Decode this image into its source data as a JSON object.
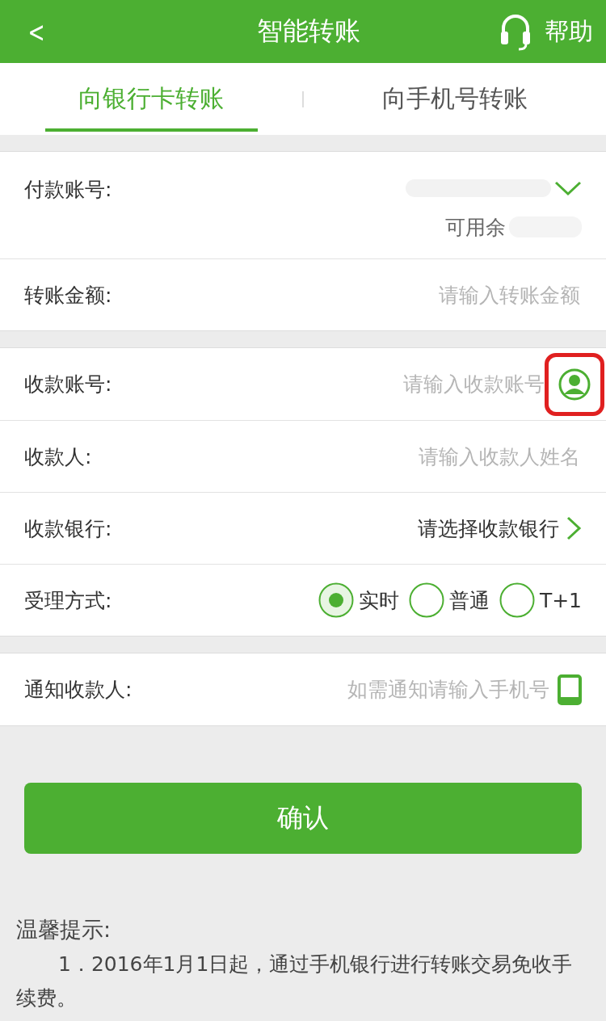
{
  "header": {
    "back": "<",
    "title": "智能转账",
    "help": "帮助"
  },
  "tabs": [
    {
      "label": "向银行卡转账",
      "selected": true
    },
    {
      "label": "向手机号转账",
      "selected": false
    }
  ],
  "sections": [
    {
      "rows": [
        {
          "kind": "account",
          "label": "付款账号:",
          "balance_label": "可用余"
        },
        {
          "kind": "input",
          "label": "转账金额:",
          "placeholder": "请输入转账金额"
        }
      ]
    },
    {
      "rows": [
        {
          "kind": "contact_input",
          "label": "收款账号:",
          "placeholder": "请输入收款账号",
          "highlighted": true
        },
        {
          "kind": "input",
          "label": "收款人:",
          "placeholder": "请输入收款人姓名"
        },
        {
          "kind": "select",
          "label": "收款银行:",
          "value": "请选择收款银行"
        },
        {
          "kind": "radio",
          "label": "受理方式:",
          "options": [
            {
              "label": "实时",
              "selected": true
            },
            {
              "label": "普通",
              "selected": false
            },
            {
              "label": "T+1",
              "selected": false
            }
          ]
        }
      ]
    },
    {
      "rows": [
        {
          "kind": "phone_input",
          "label": "通知收款人:",
          "placeholder": "如需通知请输入手机号"
        }
      ]
    }
  ],
  "confirm_button": "确认",
  "tips": {
    "title": "温馨提示:",
    "items": [
      "1．2016年1月1日起，通过手机银行进行转账交易免收手续费。"
    ]
  }
}
